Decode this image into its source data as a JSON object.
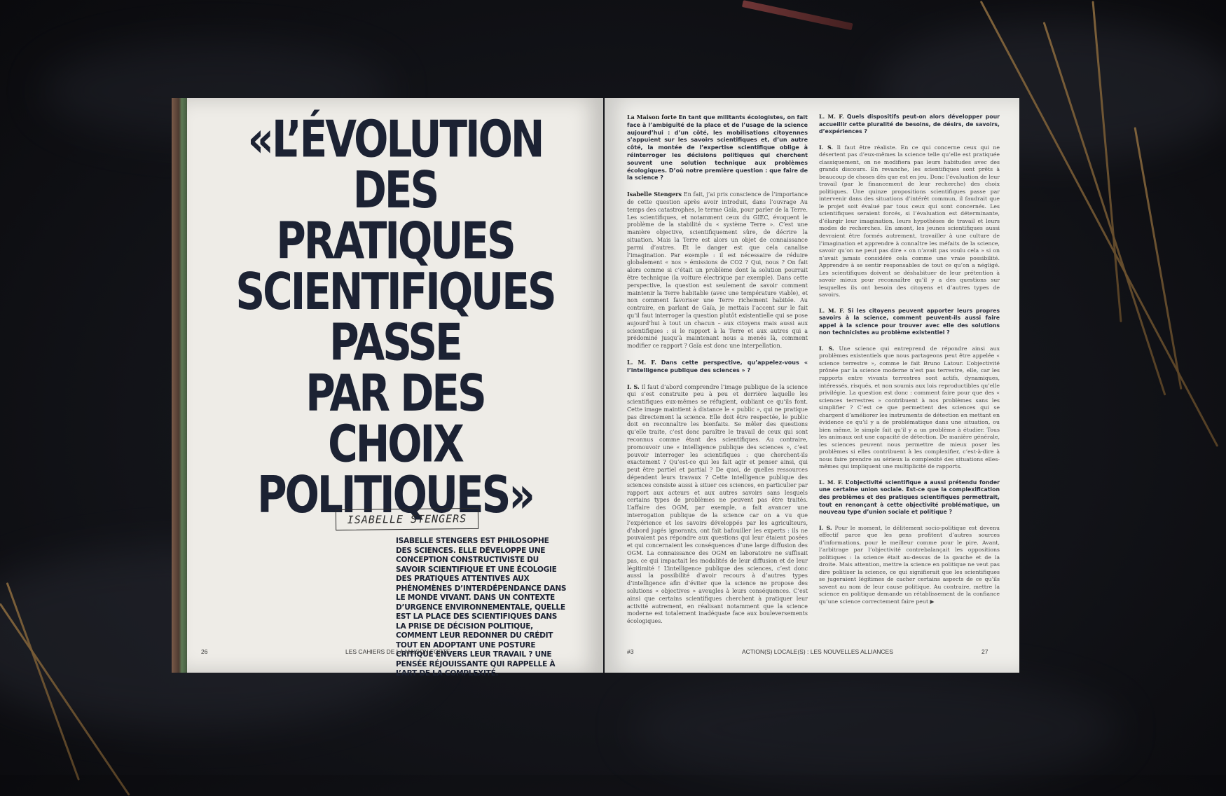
{
  "left_page": {
    "headline_lines": [
      "«L’ÉVOLUTION",
      "DES",
      "PRATIQUES",
      "SCIENTIFIQUES",
      "PASSE",
      "PAR DES",
      "CHOIX",
      "POLITIQUES»"
    ],
    "signature": "ISABELLE STENGERS",
    "intro": "ISABELLE STENGERS EST PHILOSOPHE DES SCIENCES. ELLE DÉVELOPPE UNE CONCEPTION CONSTRUCTIVISTE DU SAVOIR SCIENTIFIQUE ET UNE ÉCOLOGIE DES PRATIQUES ATTENTIVES AUX PHÉNOMÈNES D’INTERDÉPENDANCE DANS LE MONDE VIVANT. DANS UN CONTEXTE D’URGENCE ENVIRONNEMENTALE, QUELLE EST LA PLACE DES SCIENTIFIQUES DANS LA PRISE DE DÉCISION POLITIQUE, COMMENT LEUR REDONNER DU CRÉDIT TOUT EN ADOPTANT UNE POSTURE CRITIQUE ENVERS LEUR TRAVAIL ? UNE PENSÉE RÉJOUISSANTE QUI RAPPELLE À L’ART DE LA COMPLEXITÉ.",
    "page_number": "26",
    "running_title": "LES CAHIERS DE LA MAISON FORTE"
  },
  "right_page": {
    "col1": [
      {
        "speaker": "La Maison forte",
        "text": "En tant que militants écologistes, on fait face à l’ambiguïté de la place et de l’usage de la science aujourd’hui : d’un côté, les mobilisations citoyennes s’appuient sur les savoirs scientifiques et, d’un autre côté, la montée de l’expertise scientifique oblige à réinterroger les décisions politiques qui cherchent souvent une solution technique aux problèmes écologiques. D’où notre première question : que faire de la science ?"
      },
      {
        "speaker": "Isabelle Stengers",
        "text": "En fait, j’ai pris conscience de l’importance de cette question après avoir introduit, dans l’ouvrage Au temps des catastrophes, le terme Gaïa, pour parler de la Terre. Les scientifiques, et notamment ceux du GIEC, évoquent le problème de la stabilité du « système Terre ». C’est une manière objective, scientifiquement sûre, de décrire la situation. Mais la Terre est alors un objet de connaissance parmi d’autres. Et le danger est que cela canalise l’imagination. Par exemple : il est nécessaire de réduire globalement « nos » émissions de CO2 ? Qui, nous ? On fait alors comme si c’était un problème dont la solution pourrait être technique (la voiture électrique par exemple). Dans cette perspective, la question est seulement de savoir comment maintenir la Terre habitable (avec une température viable), et non comment favoriser une Terre richement habitée. Au contraire, en parlant de Gaïa, je mettais l’accent sur le fait qu’il faut interroger la question plutôt existentielle qui se pose aujourd’hui à tout un chacun – aux citoyens mais aussi aux scientifiques : si le rapport à la Terre et aux autres qui a prédominé jusqu’à maintenant nous a menés là, comment modifier ce rapport ? Gaïa est donc une interpellation."
      },
      {
        "speaker": "L. M. F.",
        "text": "Dans cette perspective, qu’appelez-vous « l’intelligence publique des sciences » ?",
        "question": true
      },
      {
        "speaker": "I. S.",
        "text": "Il faut d’abord comprendre l’image publique de la science qui s’est construite peu à peu et derrière laquelle les scientifiques eux-mêmes se réfugient, oubliant ce qu’ils font. Cette image maintient à distance le « public », qui ne pratique pas directement la science. Elle doit être respectée, le public doit en reconnaître les bienfaits. Se mêler des questions qu’elle traite, c’est donc paraître le travail de ceux qui sont reconnus comme étant des scientifiques. Au contraire, promouvoir une « intelligence publique des sciences », c’est pouvoir interroger les scientifiques : que cherchent-ils exactement ? Qu’est-ce qui les fait agir et penser ainsi, qui peut être partiel et partial ? De quoi, de quelles ressources dépendent leurs travaux ? Cette intelligence publique des sciences consiste aussi à situer ces sciences, en particulier par rapport aux acteurs et aux autres savoirs sans lesquels certains types de problèmes ne peuvent pas être traités. L’affaire des OGM, par exemple, a fait avancer une interrogation publique de la science car on a vu que l’expérience et les savoirs développés par les agriculteurs, d’abord jugés ignorants, ont fait bafouiller les experts : ils ne pouvaient pas répondre aux questions qui leur étaient posées et qui concernaient les conséquences d’une large diffusion des OGM. La connaissance des OGM en laboratoire ne suffisait pas, ce qui impactait les modalités de leur diffusion et de leur légitimité ! L’intelligence publique des sciences, c’est donc aussi la possibilité d’avoir recours à d’autres types d’intelligence afin d’éviter que la science ne propose des solutions « objectives » aveugles à leurs conséquences. C’est ainsi que certains scientifiques cherchent à pratiquer leur activité autrement, en réalisant notamment que la science moderne est totalement inadéquate face aux bouleversements écologiques."
      }
    ],
    "col2": [
      {
        "speaker": "L. M. F.",
        "text": "Quels dispositifs peut-on alors développer pour accueillir cette pluralité de besoins, de désirs, de savoirs, d’expériences ?",
        "question": true
      },
      {
        "speaker": "I. S.",
        "text": "Il faut être réaliste. En ce qui concerne ceux qui ne désertent pas d’eux-mêmes la science telle qu’elle est pratiquée classiquement, on ne modifiera pas leurs habitudes avec des grands discours. En revanche, les scientifiques sont prêts à beaucoup de choses dès que est en jeu. Donc l’évaluation de leur travail (par le financement de leur recherche) des choix politiques. Une quinze propositions scientifiques passe par intervenir dans des situations d’intérêt commun, il faudrait que le projet soit évalué par tous ceux qui sont concernés. Les scientifiques seraient forcés, si l’évaluation est déterminante, d’élargir leur imagination, leurs hypothèses de travail et leurs modes de recherches. En amont, les jeunes scientifiques aussi devraient être formés autrement, travailler à une culture de l’imagination et apprendre à connaître les méfaits de la science, savoir qu’on ne peut pas dire « on n’avait pas voulu cela » si on n’avait jamais considéré cela comme une vraie possibilité. Apprendre à se sentir responsables de tout ce qu’on a négligé. Les scientifiques doivent se déshabituer de leur prétention à savoir mieux pour reconnaître qu’il y a des questions sur lesquelles ils ont besoin des citoyens et d’autres types de savoirs."
      },
      {
        "speaker": "L. M. F.",
        "text": "Si les citoyens peuvent apporter leurs propres savoirs à la science, comment peuvent-ils aussi faire appel à la science pour trouver avec elle des solutions non technicistes au problème existentiel ?",
        "question": true
      },
      {
        "speaker": "I. S.",
        "text": "Une science qui entreprend de répondre ainsi aux problèmes existentiels que nous partageons peut être appelée « science terrestre », comme le fait Bruno Latour. L’objectivité prônée par la science moderne n’est pas terrestre, elle, car les rapports entre vivants terrestres sont actifs, dynamiques, intéressés, risqués, et non soumis aux lois reproductibles qu’elle privilégie. La question est donc : comment faire pour que des « sciences terrestres » contribuent à nos problèmes sans les simplifier ? C’est ce que permettent des sciences qui se chargent d’améliorer les instruments de détection en mettant en évidence ce qu’il y a de problématique dans une situation, ou bien même, le simple fait qu’il y a un problème à étudier. Tous les animaux ont une capacité de détection. De manière générale, les sciences peuvent nous permettre de mieux poser les problèmes si elles contribuent à les complexifier, c’est-à-dire à nous faire prendre au sérieux la complexité des situations elles-mêmes qui impliquent une multiplicité de rapports."
      },
      {
        "speaker": "L. M. F.",
        "text": "L’objectivité scientifique a aussi prétendu fonder une certaine union sociale. Est-ce que la complexification des problèmes et des pratiques scientifiques permettrait, tout en renonçant à cette objectivité problématique, un nouveau type d’union sociale et politique ?",
        "question": true
      },
      {
        "speaker": "I. S.",
        "text": "Pour le moment, le délitement socio-politique est devenu effectif parce que les gens profitent d’autres sources d’informations, pour le meilleur comme pour le pire. Avant, l’arbitrage par l’objectivité contrebalançait les oppositions politiques : la science était au-dessus de la gauche et de la droite. Mais attention, mettre la science en politique ne veut pas dire politiser la science, ce qui signifierait que les scientifiques se jugeraient légitimes de cacher certains aspects de ce qu’ils savent au nom de leur cause politique. Au contraire, mettre la science en politique demande un rétablissement de la confiance qu’une science correctement faire peut ▶"
      }
    ],
    "page_left_marker": "#3",
    "running_title": "ACTION(S) LOCALE(S) : LES NOUVELLES ALLIANCES",
    "page_number": "27"
  }
}
